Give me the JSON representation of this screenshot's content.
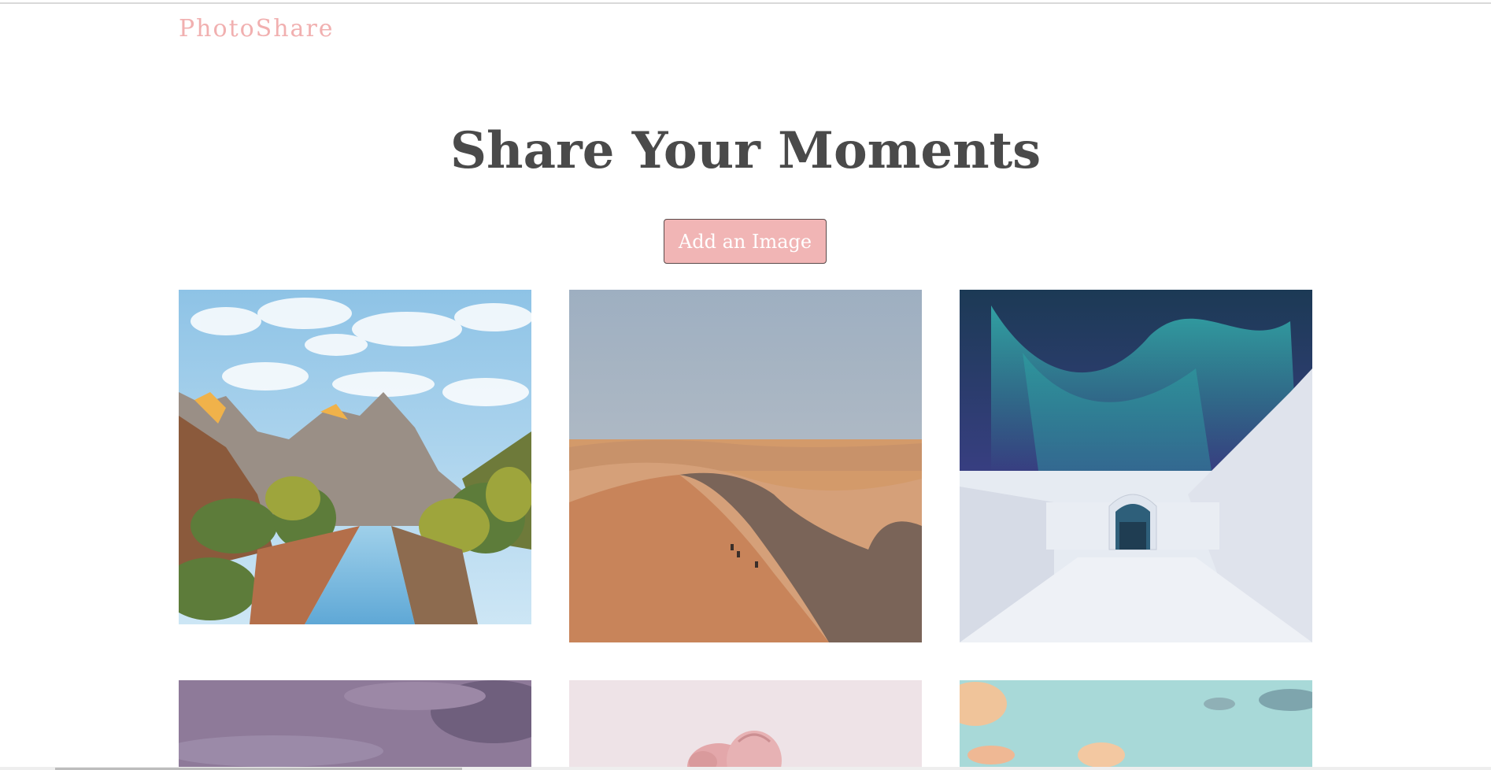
{
  "header": {
    "brand": "PhotoShare"
  },
  "hero": {
    "title": "Share Your Moments",
    "add_button_label": "Add an Image"
  },
  "gallery": {
    "images": [
      {
        "subject": "canyon-river-mountains"
      },
      {
        "subject": "desert-dunes"
      },
      {
        "subject": "aurora-ice-hotel"
      },
      {
        "subject": "purple-cloudy-sky"
      },
      {
        "subject": "pink-roses"
      },
      {
        "subject": "sunset-clouds-teal-sky"
      }
    ]
  },
  "colors": {
    "brand": "#f1b0b0",
    "button_bg": "#f1b5b5",
    "title": "#4a4a4a"
  }
}
